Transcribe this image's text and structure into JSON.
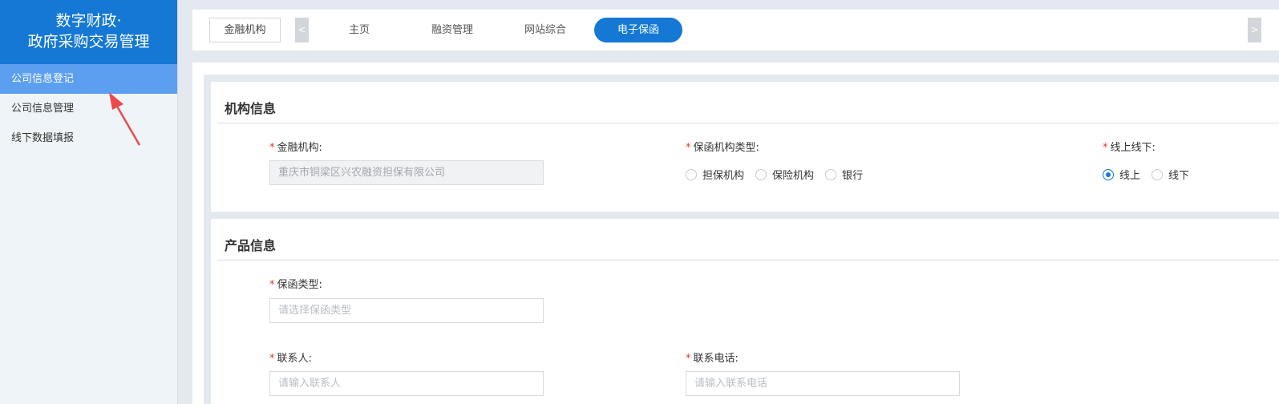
{
  "sidebar": {
    "title_line1": "数字财政·",
    "title_line2": "政府采购交易管理",
    "items": [
      {
        "label": "公司信息登记"
      },
      {
        "label": "公司信息管理"
      },
      {
        "label": "线下数据填报"
      }
    ]
  },
  "topbar": {
    "org_button": "金融机构",
    "prev_arrow": "<",
    "next_arrow": ">",
    "tabs": [
      {
        "label": "主页"
      },
      {
        "label": "融资管理"
      },
      {
        "label": "网站综合"
      },
      {
        "label": "电子保函"
      }
    ]
  },
  "org_card": {
    "title": "机构信息",
    "required_mark": "*",
    "financial_org": {
      "label": "金融机构:",
      "value": "重庆市铜梁区兴农融资担保有限公司"
    },
    "guarantee_type": {
      "label": "保函机构类型:",
      "options": [
        "担保机构",
        "保险机构",
        "银行"
      ]
    },
    "online": {
      "label": "线上线下:",
      "options": [
        "线上",
        "线下"
      ],
      "selected": "线上"
    }
  },
  "product_card": {
    "title": "产品信息",
    "letter_type": {
      "label": "保函类型:",
      "placeholder": "请选择保函类型"
    },
    "contact": {
      "label": "联系人:",
      "placeholder": "请输入联系人"
    },
    "phone": {
      "label": "联系电话:",
      "placeholder": "请输入联系电话"
    }
  },
  "colors": {
    "primary": "#1478d4",
    "sidebar_active": "#5c9ff0",
    "required": "#e03030",
    "annotation_arrow": "#ec4a4a"
  }
}
